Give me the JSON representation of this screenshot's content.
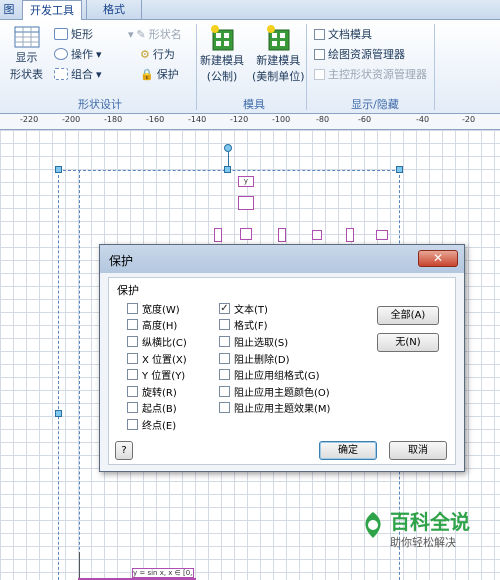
{
  "tabs": [
    "图",
    "开发工具",
    "格式"
  ],
  "ribbon": {
    "show_shapes_label1": "显示",
    "show_shapes_label2": "形状表",
    "rectangle": "矩形",
    "operations": "操作",
    "group": "组合",
    "shape_name": "形状名",
    "behavior": "行为",
    "protection": "保护",
    "group_shape_design": "形状设计",
    "new_stencil_metric1": "新建模具",
    "new_stencil_metric2": "(公制)",
    "new_stencil_us1": "新建模具",
    "new_stencil_us2": "(美制单位)",
    "group_stencil": "模具",
    "document_stencil": "文档模具",
    "drawing_explorer": "绘图资源管理器",
    "master_explorer": "主控形状资源管理器",
    "group_show_hide": "显示/隐藏"
  },
  "ruler": [
    "-220",
    "-200",
    "-180",
    "-160",
    "-140",
    "-120",
    "-100",
    "-80",
    "-60",
    "-40",
    "-20"
  ],
  "canvas": {
    "label_y": "y",
    "label_formula": "y = sin x, x ∈ [0,2π]"
  },
  "dialog": {
    "title": "保护",
    "close": "✕",
    "section": "保护",
    "left_options": [
      {
        "label": "宽度(W)",
        "checked": false
      },
      {
        "label": "高度(H)",
        "checked": false
      },
      {
        "label": "纵横比(C)",
        "checked": false
      },
      {
        "label": "X 位置(X)",
        "checked": false
      },
      {
        "label": "Y 位置(Y)",
        "checked": false
      },
      {
        "label": "旋转(R)",
        "checked": false
      },
      {
        "label": "起点(B)",
        "checked": false
      },
      {
        "label": "终点(E)",
        "checked": false
      }
    ],
    "right_options": [
      {
        "label": "文本(T)",
        "checked": true
      },
      {
        "label": "格式(F)",
        "checked": false
      },
      {
        "label": "阻止选取(S)",
        "checked": false
      },
      {
        "label": "阻止删除(D)",
        "checked": false
      },
      {
        "label": "阻止应用组格式(G)",
        "checked": false
      },
      {
        "label": "阻止应用主题颜色(O)",
        "checked": false
      },
      {
        "label": "阻止应用主题效果(M)",
        "checked": false
      }
    ],
    "btn_all": "全部(A)",
    "btn_none": "无(N)",
    "help": "?",
    "ok": "确定",
    "cancel": "取消"
  },
  "watermark": {
    "title": "百科全说",
    "subtitle": "助你轻松解决"
  }
}
